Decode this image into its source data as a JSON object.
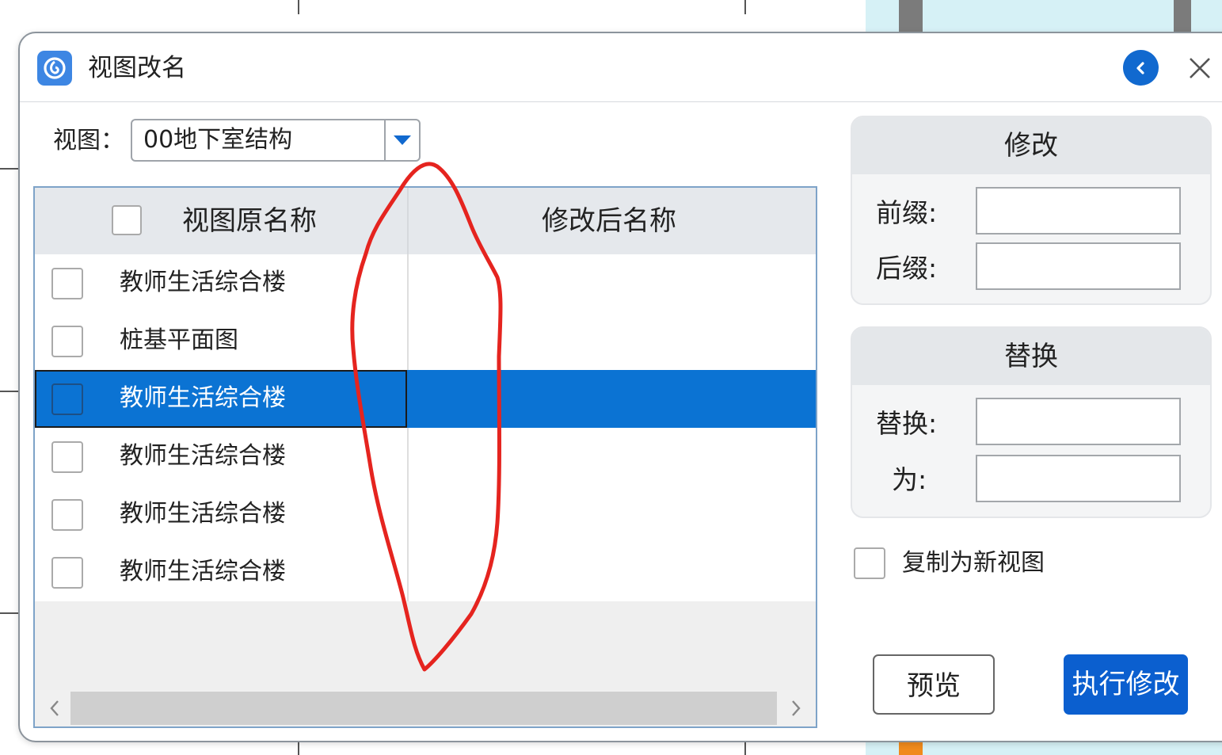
{
  "dialog": {
    "title": "视图改名",
    "view_label": "视图：",
    "view_value": "00地下室结构"
  },
  "table": {
    "headers": [
      "视图原名称",
      "修改后名称"
    ],
    "rows": [
      {
        "original": "教师生活综合楼",
        "renamed": "",
        "selected": false
      },
      {
        "original": "桩基平面图",
        "renamed": "",
        "selected": false
      },
      {
        "original": "教师生活综合楼",
        "renamed": "",
        "selected": true
      },
      {
        "original": "教师生活综合楼",
        "renamed": "",
        "selected": false
      },
      {
        "original": "教师生活综合楼",
        "renamed": "",
        "selected": false
      },
      {
        "original": "教师生活综合楼",
        "renamed": "",
        "selected": false
      }
    ]
  },
  "modify_group": {
    "title": "修改",
    "prefix_label": "前缀:",
    "suffix_label": "后缀:",
    "prefix_value": "",
    "suffix_value": ""
  },
  "replace_group": {
    "title": "替换",
    "replace_label": "替换:",
    "with_label": "为:",
    "replace_value": "",
    "with_value": ""
  },
  "copy_option": {
    "label": "复制为新视图",
    "checked": false
  },
  "buttons": {
    "preview": "预览",
    "execute": "执行修改"
  },
  "colors": {
    "accent": "#0b5fcf",
    "selection": "#0b73d3",
    "annotation": "#e5241f"
  }
}
